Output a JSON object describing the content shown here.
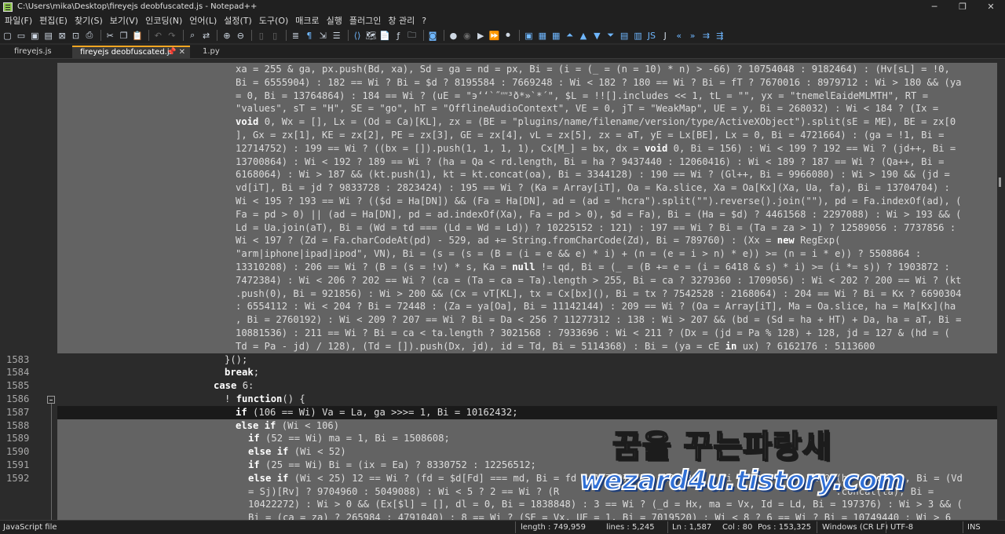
{
  "window": {
    "title": "C:\\Users\\mika\\Desktop\\fireyejs deobfuscated.js - Notepad++",
    "buttons": [
      "─",
      "❐",
      "✕"
    ]
  },
  "menu": [
    "파일(F)",
    "편집(E)",
    "찾기(S)",
    "보기(V)",
    "인코딩(N)",
    "언어(L)",
    "설정(T)",
    "도구(O)",
    "매크로",
    "실행",
    "플러그인",
    "창 관리",
    "?"
  ],
  "tabs": [
    {
      "label": "fireyejs.js"
    },
    {
      "label": "fireyejs deobfuscated.js",
      "icons": "📌 ✕"
    },
    {
      "label": "1.py"
    }
  ],
  "editor": {
    "cont_lines": [
      "xa = 255 & ga, px.push(Bd, xa), Sd = ga = nd = px, Bi = (i = (_ = (n = 10) * n) > -66) ? 10754048 : 9182464) : (Hv[sL] = !0,",
      "Bi = 6555904) : 182 == Wi ? Bi = $d ? 8195584 : 7669248 : Wi < 182 ? 180 == Wi ? Bi = fT ? 7670016 : 8979712 : Wi > 180 && (ya",
      "= 0, Bi = 13764864) : 184 == Wi ? (uE = \"϶ʻʻ`˝ʺʺ³ð*»`*´\", $L = !![].includes << 1, tL = \"\", yx = \"tnemelEaideMLMTH\", RT =",
      "\"values\", sT = \"H\", SE = \"go\", hT = \"OfflineAudioContext\", VE = 0, jT = \"WeakMap\", UE = y, Bi = 268032) : Wi < 184 ? (Ix =",
      "void 0, Wx = [], Lx = (Od = Ca)[KL], zx = (BE = \"plugins/name/filename/version/type/ActiveXObject\").split(sE = ME), BE = zx[0",
      "], Gx = zx[1], KE = zx[2], PE = zx[3], GE = zx[4], vL = zx[5], zx = aT, yE = Lx[BE], Lx = 0, Bi = 4721664) : (ga = !1, Bi =",
      "12714752) : 199 == Wi ? ((bx = []).push(1, 1, 1, 1), Cx[M_] = bx, dx = void 0, Bi = 156) : Wi < 199 ? 192 == Wi ? (jd++, Bi =",
      "13700864) : Wi < 192 ? 189 == Wi ? (ha = Qa < rd.length, Bi = ha ? 9437440 : 12060416) : Wi < 189 ? 187 == Wi ? (Qa++, Bi =",
      "6168064) : Wi > 187 && (kt.push(1), kt = kt.concat(oa), Bi = 3344128) : 190 == Wi ? (Gl++, Bi = 9966080) : Wi > 190 && (jd =",
      "vd[iT], Bi = jd ? 9833728 : 2823424) : 195 == Wi ? (Ka = Array[iT], Oa = Ka.slice, Xa = Oa[Kx](Xa, Ua, fa), Bi = 13704704) :",
      "Wi < 195 ? 193 == Wi ? (($d = Ha[DN]) && (Fa = Ha[DN], ad = (ad = \"hcra\").split(\"\").reverse().join(\"\"), pd = Fa.indexOf(ad), (",
      "Fa = pd > 0) || (ad = Ha[DN], pd = ad.indexOf(Xa), Fa = pd > 0), $d = Fa), Bi = (Ha = $d) ? 4461568 : 2297088) : Wi > 193 && (",
      "Ld = Ua.join(aT), Bi = (Wd = td === (Ld = Wd = Ld)) ? 10225152 : 121) : 197 == Wi ? Bi = (Ta = za > 1) ? 12589056 : 7737856 :",
      "Wi < 197 ? (Zd = Fa.charCodeAt(pd) - 529, ad += String.fromCharCode(Zd), Bi = 789760) : (Xx = new RegExp(",
      "\"arm|iphone|ipad|ipod\", VN), Bi = (s = (s = (B = (i = e && e) * i) + (n = (e = i > n) * e)) >= (n = i * e)) ? 5508864 :",
      "13310208) : 206 == Wi ? (B = (s = !v) * s, Ka = null != qd, Bi = (_ = (B += e = (i = 6418 & s) * i) >= (i *= s)) ? 1903872 :",
      "7472384) : Wi < 206 ? 202 == Wi ? (ca = (Ta = ca = Ta).length > 255, Bi = ca ? 3279360 : 1709056) : Wi < 202 ? 200 == Wi ? (kt",
      ".push(0), Bi = 921856) : Wi > 200 && (Cx = vT[KL], tx = Cx[bx](), Bi = tx ? 7542528 : 2168064) : 204 == Wi ? Bi = Kx ? 6690304",
      ": 6554112 : Wi < 204 ? Bi = 72448 : (Za = ya[Oa], Bi = 11142144) : 209 == Wi ? (Oa = Array[iT], Ma = Oa.slice, ha = Ma[Kx](ha",
      ", Bi = 2760192) : Wi < 209 ? 207 == Wi ? Bi = Da < 256 ? 11277312 : 138 : Wi > 207 && (bd = (Sd = ha + HT) + Da, ha = aT, Bi =",
      "10881536) : 211 == Wi ? Bi = ca < ta.length ? 3021568 : 7933696 : Wi < 211 ? (Dx = (jd = Pa % 128) + 128, jd = 127 & (hd = (",
      "Td = Pa - jd) / 128), (Td = []).push(Dx, jd), id = Td, Bi = 5114368) : Bi = (ya = cE in ux) ? 6162176 : 5113600"
    ],
    "numbered": [
      {
        "num": "1583",
        "text": "}();"
      },
      {
        "num": "1584",
        "text": "break;"
      },
      {
        "num": "1585",
        "text": "case 6:"
      },
      {
        "num": "1586",
        "text": "! function() {"
      },
      {
        "num": "1587",
        "text": "if (106 == Wi) Va = La, ga >>>= 1, Bi = 10162432;"
      },
      {
        "num": "1588",
        "text": "else if (Wi < 106)"
      },
      {
        "num": "1589",
        "text": "if (52 == Wi) ma = 1, Bi = 1508608;"
      },
      {
        "num": "1590",
        "text": "else if (Wi < 52)"
      },
      {
        "num": "1591",
        "text": "if (25 == Wi) Bi = (ix = Ea) ? 8330752 : 12256512;"
      },
      {
        "num": "1592",
        "text": "else if (Wi < 25) 12 == Wi ? (fd = $d[Fd] === md, Bi = fd ? 13780736 : 2100480) : Wi < 12 ? 5 == Wi ? (ha = void 0, Bi = (Vd"
      }
    ],
    "tail_lines": [
      "= Sj)[Rv] ? 9704960 : 5049088) : Wi < 5 ? 2 == Wi ? (R                                                .concat(ta), Bi =",
      "10422272) : Wi > 0 && (Ex[$l] = [], dl = 0, Bi = 1838848) : 3 == Wi ? (_d = Hx, ma = Vx, Id = Ld, Bi = 197376) : Wi > 3 && (",
      "Bi = (ca = za) ? 265984 : 4791040) : 8 == Wi ? (SE = Vx, UE = 1, Bi = 7019520) : Wi < 8 ? 6 == Wi ? Bi = 10749440 : Wi > 6"
    ]
  },
  "watermark": {
    "korean": "꿈을 꾸는파랑새",
    "site": "wezard4u.tistory.com"
  },
  "status": {
    "filetype": "JavaScript file",
    "length": "length : 749,959",
    "lines": "lines : 5,245",
    "ln": "Ln : 1,587",
    "col": "Col : 80",
    "pos": "Pos : 153,325",
    "eol": "Windows (CR LF)",
    "encoding": "UTF-8",
    "mode": "INS"
  }
}
